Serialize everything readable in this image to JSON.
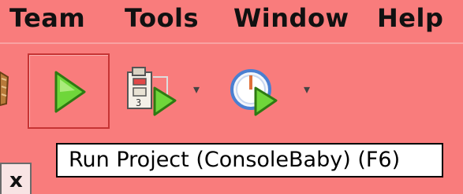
{
  "menu": {
    "items": [
      {
        "label": "Team"
      },
      {
        "label": "Tools"
      },
      {
        "label": "Window"
      },
      {
        "label": "Help"
      }
    ]
  },
  "toolbar": {
    "run_button_icon": "run-play-icon",
    "run_file_icon": "run-file-icon",
    "profile_icon": "profile-stopwatch-icon",
    "dropdown_glyph": "▾"
  },
  "tooltip": {
    "text": "Run Project (ConsoleBaby) (F6)"
  },
  "tab": {
    "close_label": "x"
  },
  "colors": {
    "background": "#f97c7c",
    "play_green": "#5cbf2a",
    "tooltip_bg": "#ffffff"
  }
}
